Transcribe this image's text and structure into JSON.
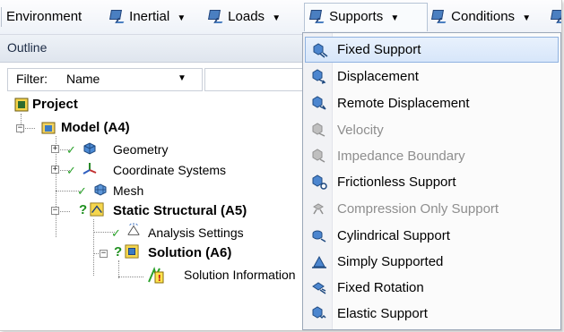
{
  "toolbar": {
    "items": [
      {
        "label": "Environment",
        "icon": "none"
      },
      {
        "label": "Inertial",
        "icon": "inertial-icon"
      },
      {
        "label": "Loads",
        "icon": "loads-icon"
      },
      {
        "label": "Supports",
        "icon": "supports-icon"
      },
      {
        "label": "Conditions",
        "icon": "conditions-icon"
      }
    ],
    "caret": "▼"
  },
  "outline": {
    "title": "Outline",
    "filter_label": "Filter:",
    "filter_value": "Name",
    "filter_caret": "▼"
  },
  "tree": [
    {
      "label": "Project",
      "icon": "project-icon"
    },
    {
      "label": "Model (A4)",
      "icon": "model-icon"
    },
    {
      "label": "Geometry",
      "icon": "geometry-icon"
    },
    {
      "label": "Coordinate Systems",
      "icon": "coordinate-systems-icon"
    },
    {
      "label": "Mesh",
      "icon": "mesh-icon"
    },
    {
      "label": "Static Structural (A5)",
      "icon": "static-structural-icon"
    },
    {
      "label": "Analysis Settings",
      "icon": "analysis-settings-icon"
    },
    {
      "label": "Solution (A6)",
      "icon": "solution-icon"
    },
    {
      "label": "Solution Information",
      "icon": "solution-information-icon"
    }
  ],
  "menu": {
    "items": [
      {
        "label": "Fixed Support",
        "enabled": true,
        "highlighted": true,
        "icon": "fixed-support-icon"
      },
      {
        "label": "Displacement",
        "enabled": true,
        "icon": "displacement-icon"
      },
      {
        "label": "Remote Displacement",
        "enabled": true,
        "icon": "remote-displacement-icon"
      },
      {
        "label": "Velocity",
        "enabled": false,
        "icon": "velocity-icon"
      },
      {
        "label": "Impedance Boundary",
        "enabled": false,
        "icon": "impedance-boundary-icon"
      },
      {
        "label": "Frictionless Support",
        "enabled": true,
        "icon": "frictionless-support-icon"
      },
      {
        "label": "Compression Only Support",
        "enabled": false,
        "icon": "compression-only-support-icon"
      },
      {
        "label": "Cylindrical Support",
        "enabled": true,
        "icon": "cylindrical-support-icon"
      },
      {
        "label": "Simply Supported",
        "enabled": true,
        "icon": "simply-supported-icon"
      },
      {
        "label": "Fixed Rotation",
        "enabled": true,
        "icon": "fixed-rotation-icon"
      },
      {
        "label": "Elastic Support",
        "enabled": true,
        "icon": "elastic-support-icon"
      }
    ]
  },
  "colors": {
    "highlight_bg": "#dbe8fb",
    "highlight_border": "#8fb2e0",
    "disabled_text": "#8e8e8e",
    "check_green": "#2aa12a"
  }
}
